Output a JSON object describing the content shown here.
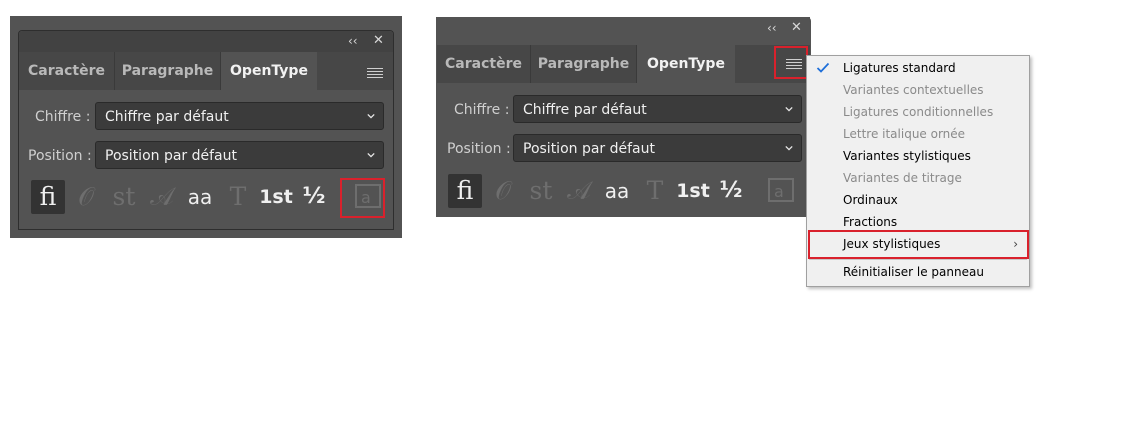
{
  "panels": [
    {
      "tabs": [
        "Caractère",
        "Paragraphe",
        "OpenType"
      ],
      "active_tab": "OpenType",
      "collapse_glyph": "‹‹",
      "close_glyph": "✕",
      "chiffre_label": "Chiffre :",
      "chiffre_value": "Chiffre par défaut",
      "position_label": "Position :",
      "position_value": "Position par défaut",
      "glyphs": [
        "fi",
        "𝒪",
        "st",
        "𝒜",
        "aa",
        "T",
        "1st",
        "½",
        "a"
      ]
    },
    {
      "tabs": [
        "Caractère",
        "Paragraphe",
        "OpenType"
      ],
      "active_tab": "OpenType",
      "collapse_glyph": "‹‹",
      "close_glyph": "✕",
      "chiffre_label": "Chiffre :",
      "chiffre_value": "Chiffre par défaut",
      "position_label": "Position :",
      "position_value": "Position par défaut",
      "glyphs": [
        "fi",
        "𝒪",
        "st",
        "𝒜",
        "aa",
        "T",
        "1st",
        "½",
        "a"
      ]
    }
  ],
  "menu": {
    "items": [
      {
        "label": "Ligatures standard",
        "checked": true,
        "enabled": true
      },
      {
        "label": "Variantes contextuelles",
        "enabled": false
      },
      {
        "label": "Ligatures conditionnelles",
        "enabled": false
      },
      {
        "label": "Lettre italique ornée",
        "enabled": false
      },
      {
        "label": "Variantes stylistiques",
        "enabled": true
      },
      {
        "label": "Variantes de titrage",
        "enabled": false
      },
      {
        "label": "Ordinaux",
        "enabled": true
      },
      {
        "label": "Fractions",
        "enabled": true
      },
      {
        "label": "Jeux stylistiques",
        "enabled": true,
        "submenu_arrow": "›"
      },
      {
        "label": "Réinitialiser le panneau",
        "enabled": true
      }
    ]
  },
  "colors": {
    "highlight": "#d9212c",
    "check": "#1e6fd9"
  },
  "icons": [
    "collapse-icon",
    "close-icon",
    "panel-menu-icon",
    "chevron-down-icon",
    "checkmark-icon",
    "submenu-arrow-icon"
  ]
}
